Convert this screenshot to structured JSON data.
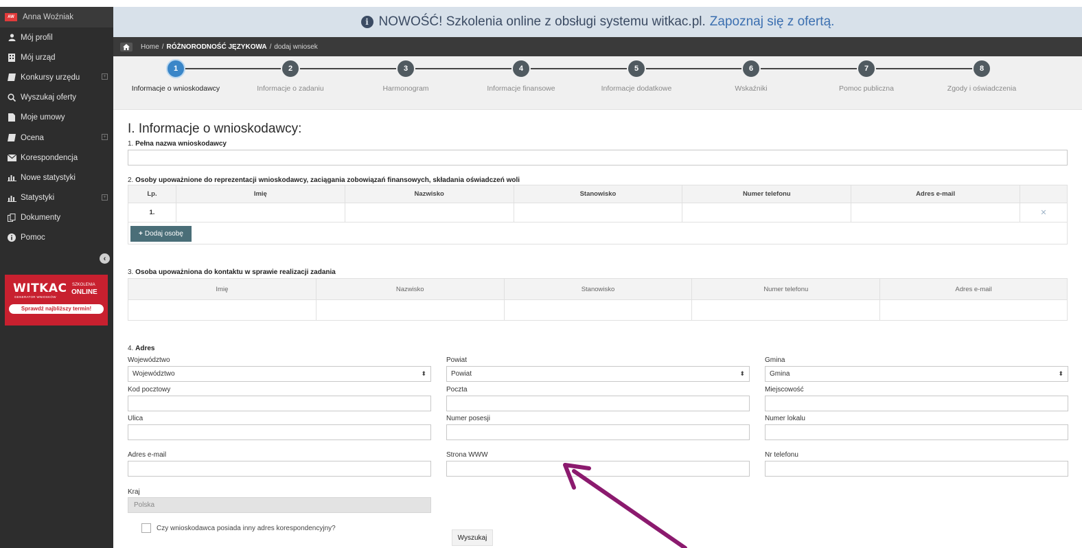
{
  "sidebar": {
    "user_initials": "AW",
    "user_name": "Anna Woźniak",
    "items": [
      {
        "label": "Mój profil"
      },
      {
        "label": "Mój urząd"
      },
      {
        "label": "Konkursy urzędu"
      },
      {
        "label": "Wyszukaj oferty"
      },
      {
        "label": "Moje umowy"
      },
      {
        "label": "Ocena"
      },
      {
        "label": "Korespondencja"
      },
      {
        "label": "Nowe statystyki"
      },
      {
        "label": "Statystyki"
      },
      {
        "label": "Dokumenty"
      },
      {
        "label": "Pomoc"
      }
    ],
    "ad": {
      "brand": "WITKAC",
      "brand_sub": "GENERATOR WNIOSKÓW",
      "tag_small": "SZKOLENIA",
      "tag_big": "ONLINE",
      "cta": "Sprawdź najbliższy termin!"
    }
  },
  "banner": {
    "text": "NOWOŚĆ! Szkolenia online z obsługi systemu witkac.pl.",
    "link": "Zapoznaj się z ofertą."
  },
  "breadcrumb": {
    "home": "Home",
    "section": "RÓŻNORODNOŚĆ JĘZYKOWA",
    "page": "dodaj wniosek"
  },
  "steps": [
    {
      "num": "1",
      "label": "Informacje o wnioskodawcy"
    },
    {
      "num": "2",
      "label": "Informacje o zadaniu"
    },
    {
      "num": "3",
      "label": "Harmonogram"
    },
    {
      "num": "4",
      "label": "Informacje finansowe"
    },
    {
      "num": "5",
      "label": "Informacje dodatkowe"
    },
    {
      "num": "6",
      "label": "Wskaźniki"
    },
    {
      "num": "7",
      "label": "Pomoc publiczna"
    },
    {
      "num": "8",
      "label": "Zgody i oświadczenia"
    }
  ],
  "form": {
    "title": "I. Informacje o wnioskodawcy:",
    "q1_num": "1.",
    "q1_label": "Pełna nazwa wnioskodawcy",
    "q2_num": "2.",
    "q2_label": "Osoby upoważnione do reprezentacji wnioskodawcy, zaciągania zobowiązań finansowych, składania oświadczeń woli",
    "q2_columns": [
      "Lp.",
      "Imię",
      "Nazwisko",
      "Stanowisko",
      "Numer telefonu",
      "Adres e-mail"
    ],
    "q2_row_num": "1.",
    "add_person": "Dodaj osobę",
    "q3_num": "3.",
    "q3_label": "Osoba upoważniona do kontaktu w sprawie realizacji zadania",
    "q3_columns": [
      "Imię",
      "Nazwisko",
      "Stanowisko",
      "Numer telefonu",
      "Adres e-mail"
    ],
    "q4_num": "4.",
    "q4_label": "Adres",
    "address": {
      "wojewodztwo_label": "Województwo",
      "wojewodztwo_value": "Województwo",
      "powiat_label": "Powiat",
      "powiat_value": "Powiat",
      "gmina_label": "Gmina",
      "gmina_value": "Gmina",
      "kod_label": "Kod pocztowy",
      "poczta_label": "Poczta",
      "miejscowosc_label": "Miejscowość",
      "ulica_label": "Ulica",
      "posesja_label": "Numer posesji",
      "lokal_label": "Numer lokalu",
      "email_label": "Adres e-mail",
      "www_label": "Strona WWW",
      "tel_label": "Nr telefonu",
      "kraj_label": "Kraj",
      "kraj_value": "Polska"
    },
    "corr_checkbox_label": "Czy wnioskodawca posiada inny adres korespondencyjny?",
    "search_button": "Wyszukaj"
  },
  "colors": {
    "annotation_arrow": "#8b1a6e",
    "active_step": "#3a86c8",
    "sidebar_bg": "#2d2d2d"
  }
}
